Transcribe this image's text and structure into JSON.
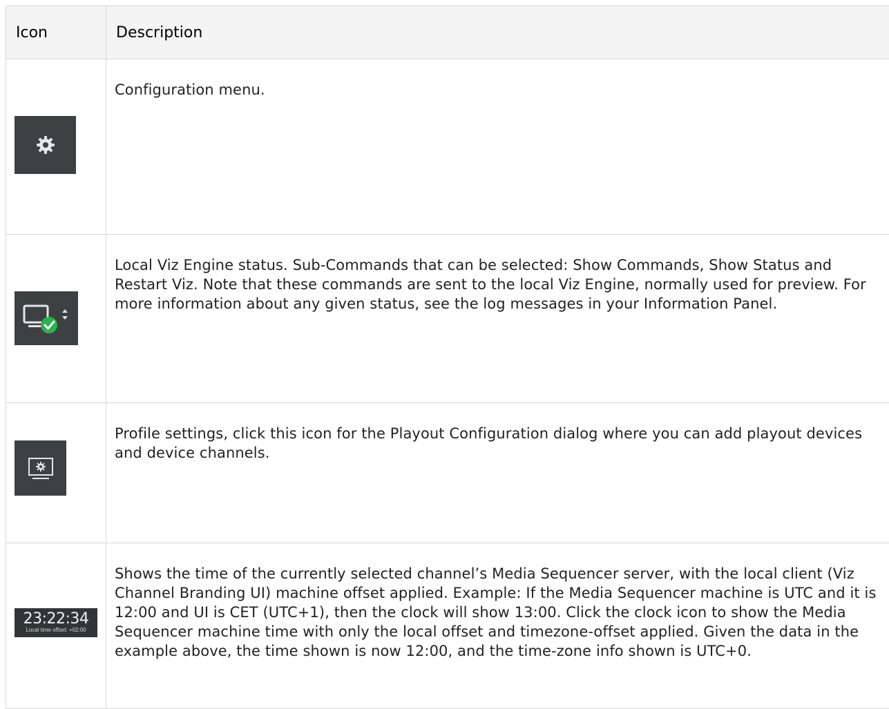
{
  "table": {
    "headers": {
      "icon": "Icon",
      "description": "Description"
    },
    "rows": [
      {
        "icon": "gear-icon",
        "description": "Configuration menu."
      },
      {
        "icon": "viz-engine-status-icon",
        "description": "Local Viz Engine status. Sub-Commands that can be selected: Show Commands, Show Status and Restart Viz. Note that these commands are sent to the local Viz Engine, normally used for preview. For more information about any given status, see the log messages in your Information Panel."
      },
      {
        "icon": "profile-settings-icon",
        "description": "Profile settings, click this icon for the Playout Configuration dialog where you can add playout devices and device channels."
      },
      {
        "icon": "clock-icon",
        "clock_time": "23:22:34",
        "clock_offset": "Local time offset: +02:00",
        "description": "Shows the time of the currently selected channel’s Media Sequencer server, with the local client (Viz Channel Branding UI) machine offset applied. Example: If the Media Sequencer machine is UTC and it is 12:00 and UI is CET (UTC+1), then the clock will show 13:00. Click the clock icon to show the Media Sequencer machine time with only the local offset and timezone-offset applied. Given the data in the example above, the time shown is now 12:00, and the time-zone info shown is UTC+0."
      }
    ]
  },
  "colors": {
    "tile_background": "#3f4042",
    "status_ok": "#2bb24c",
    "header_background": "#f4f4f4",
    "border": "#d7d7d7"
  }
}
